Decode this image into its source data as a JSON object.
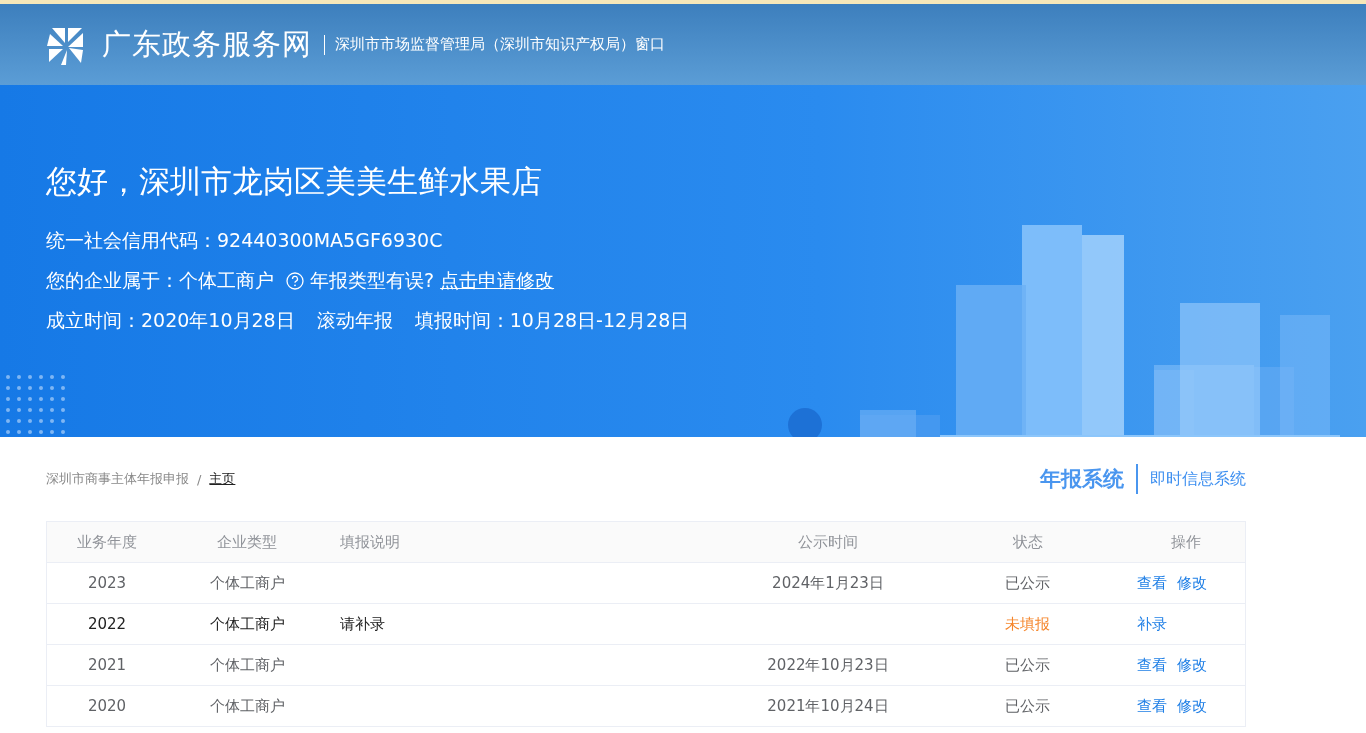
{
  "header": {
    "site_name": "广东政务服务网",
    "department": "深圳市市场监督管理局（深圳市知识产权局）窗口"
  },
  "banner": {
    "greeting": "您好，深圳市龙岗区美美生鲜水果店",
    "credit_code": "统一社会信用代码：92440300MA5GF6930C",
    "enterprise_type": "您的企业属于：个体工商户",
    "type_error_hint": "年报类型有误?",
    "apply_link": "点击申请修改",
    "established": "成立时间：2020年10月28日",
    "report_mode": "滚动年报",
    "fill_period": "填报时间：10月28日-12月28日"
  },
  "breadcrumb_separator": "/",
  "breadcrumb": [
    {
      "label": "深圳市商事主体年报申报",
      "current": false
    },
    {
      "label": "主页",
      "current": true
    }
  ],
  "system_tabs": [
    {
      "label": "年报系统",
      "selected": true
    },
    {
      "label": "即时信息系统",
      "selected": false
    }
  ],
  "table": {
    "columns": [
      "业务年度",
      "企业类型",
      "填报说明",
      "公示时间",
      "状态",
      "操作"
    ],
    "rows": [
      {
        "year": "2023",
        "type": "个体工商户",
        "note": "",
        "publish_date": "2024年1月23日",
        "status": "已公示",
        "color": "#606266",
        "actions": [
          "查看",
          "修改"
        ]
      },
      {
        "year": "2022",
        "type": "个体工商户",
        "note": "请补录",
        "publish_date": "",
        "status": "未填报",
        "color": "#f5862c",
        "actions": [
          "补录"
        ]
      },
      {
        "year": "2021",
        "type": "个体工商户",
        "note": "",
        "publish_date": "2022年10月23日",
        "status": "已公示",
        "color": "#606266",
        "actions": [
          "查看",
          "修改"
        ]
      },
      {
        "year": "2020",
        "type": "个体工商户",
        "note": "",
        "publish_date": "2021年10月24日",
        "status": "已公示",
        "color": "#606266",
        "actions": [
          "查看",
          "修改"
        ]
      }
    ]
  }
}
